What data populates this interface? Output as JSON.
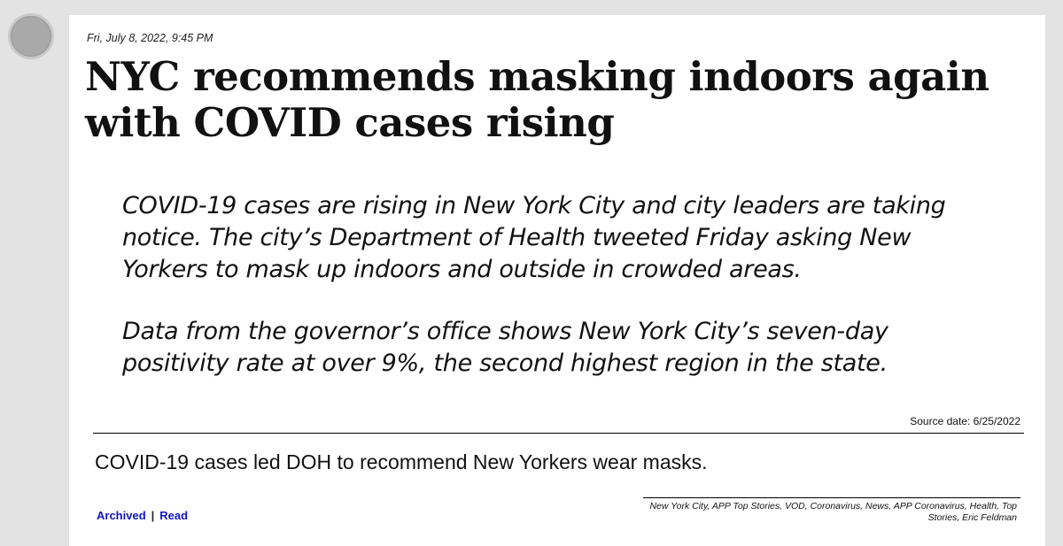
{
  "article": {
    "date": "Fri, July 8, 2022, 9:45 PM",
    "title": "NYC recommends masking indoors again with COVID cases rising",
    "summary": [
      "COVID-19 cases are rising in New York City and city leaders are taking notice. The city’s Department of Health tweeted Friday asking New Yorkers to mask up indoors and outside in crowded areas.",
      "Data from the governor’s office shows New York City’s seven-day positivity rate at over 9%, the second highest region in the state."
    ],
    "source_date": "Source date: 6/25/2022",
    "caption": "COVID-19 cases led DOH to recommend New Yorkers wear masks.",
    "links": {
      "archived": "Archived",
      "separator": "|",
      "read": "Read"
    },
    "tags": "New York City, APP Top Stories, VOD, Coronavirus, News, APP Coronavirus, Health, Top Stories, Eric Feldman"
  },
  "colors": {
    "background": "#e3e3e3",
    "card": "#ffffff",
    "link": "#0f14c9"
  },
  "icons": {
    "avatar": "avatar-circle"
  }
}
